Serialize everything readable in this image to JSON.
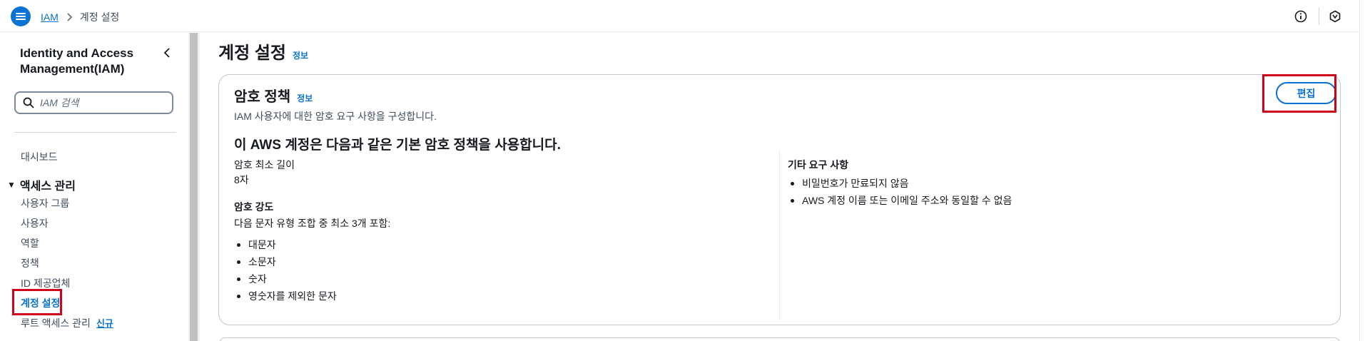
{
  "header": {
    "breadcrumb_root": "IAM",
    "breadcrumb_current": "계정 설정",
    "icons": [
      "menu-icon",
      "chevron-right-icon",
      "info-circle-icon",
      "settings-hex-icon"
    ]
  },
  "sidebar": {
    "title": "Identity and Access Management(IAM)",
    "search_placeholder": "IAM 검색",
    "dashboard": "대시보드",
    "section_label": "액세스 관리",
    "items": [
      {
        "label": "사용자 그룹"
      },
      {
        "label": "사용자"
      },
      {
        "label": "역할"
      },
      {
        "label": "정책"
      },
      {
        "label": "ID 제공업체"
      },
      {
        "label": "계정 설정"
      },
      {
        "label": "루트 액세스 관리"
      }
    ],
    "new_badge": "신규"
  },
  "main": {
    "page_title": "계정 설정",
    "info_link": "정보",
    "password_policy": {
      "title": "암호 정책",
      "info_link": "정보",
      "description": "IAM 사용자에 대한 암호 요구 사항을 구성합니다.",
      "edit_button": "편집",
      "subtitle": "이 AWS 계정은 다음과 같은 기본 암호 정책을 사용합니다.",
      "min_length_label": "암호 최소 길이",
      "min_length_value": "8자",
      "strength_label": "암호 강도",
      "strength_desc": "다음 문자 유형 조합 중 최소 3개 포함:",
      "strength_items": [
        "대문자",
        "소문자",
        "숫자",
        "영숫자를 제외한 문자"
      ],
      "other_label": "기타 요구 사항",
      "other_items": [
        "비밀번호가 만료되지 않음",
        "AWS 계정 이름 또는 이메일 주소와 동일할 수 없음"
      ]
    }
  },
  "colors": {
    "accent": "#0972d3",
    "highlight": "#d0021b",
    "text": "#16191f"
  }
}
